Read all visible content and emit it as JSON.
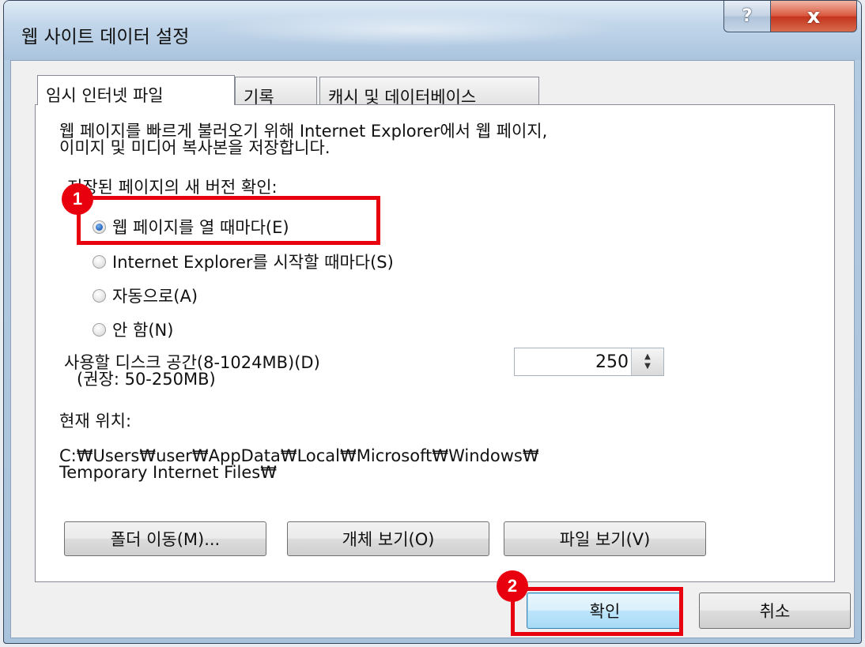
{
  "window": {
    "title": "웹 사이트 데이터 설정",
    "help_label": "?",
    "close_label": "x"
  },
  "tabs": [
    {
      "label": "임시 인터넷 파일"
    },
    {
      "label": "기록"
    },
    {
      "label": "캐시 및 데이터베이스"
    }
  ],
  "panel": {
    "description_line1": "웹 페이지를 빠르게 불러오기 위해 Internet Explorer에서 웹 페이지,",
    "description_line2": "이미지 및 미디어 복사본을 저장합니다.",
    "check_heading": "저장된 페이지의 새 버전 확인:",
    "radio_options": [
      {
        "label": "웹 페이지를 열 때마다(E)",
        "checked": true
      },
      {
        "label": "Internet Explorer를 시작할 때마다(S)",
        "checked": false
      },
      {
        "label": "자동으로(A)",
        "checked": false
      },
      {
        "label": "안 함(N)",
        "checked": false
      }
    ],
    "disk_label_line1": "사용할 디스크 공간(8-1024MB)(D)",
    "disk_label_line2": "(권장: 50-250MB)",
    "disk_value": "250",
    "location_heading": "현재 위치:",
    "location_line1": "C:₩Users₩user₩AppData₩Local₩Microsoft₩Windows₩",
    "location_line2": "Temporary Internet Files₩",
    "move_folder_button": "폴더 이동(M)...",
    "view_objects_button": "개체 보기(O)",
    "view_files_button": "파일 보기(V)"
  },
  "footer": {
    "ok_button": "확인",
    "cancel_button": "취소"
  },
  "annotations": [
    {
      "number": "1"
    },
    {
      "number": "2"
    }
  ],
  "colors": {
    "annotation": "#e8000e",
    "close_button": "#c3341c"
  }
}
